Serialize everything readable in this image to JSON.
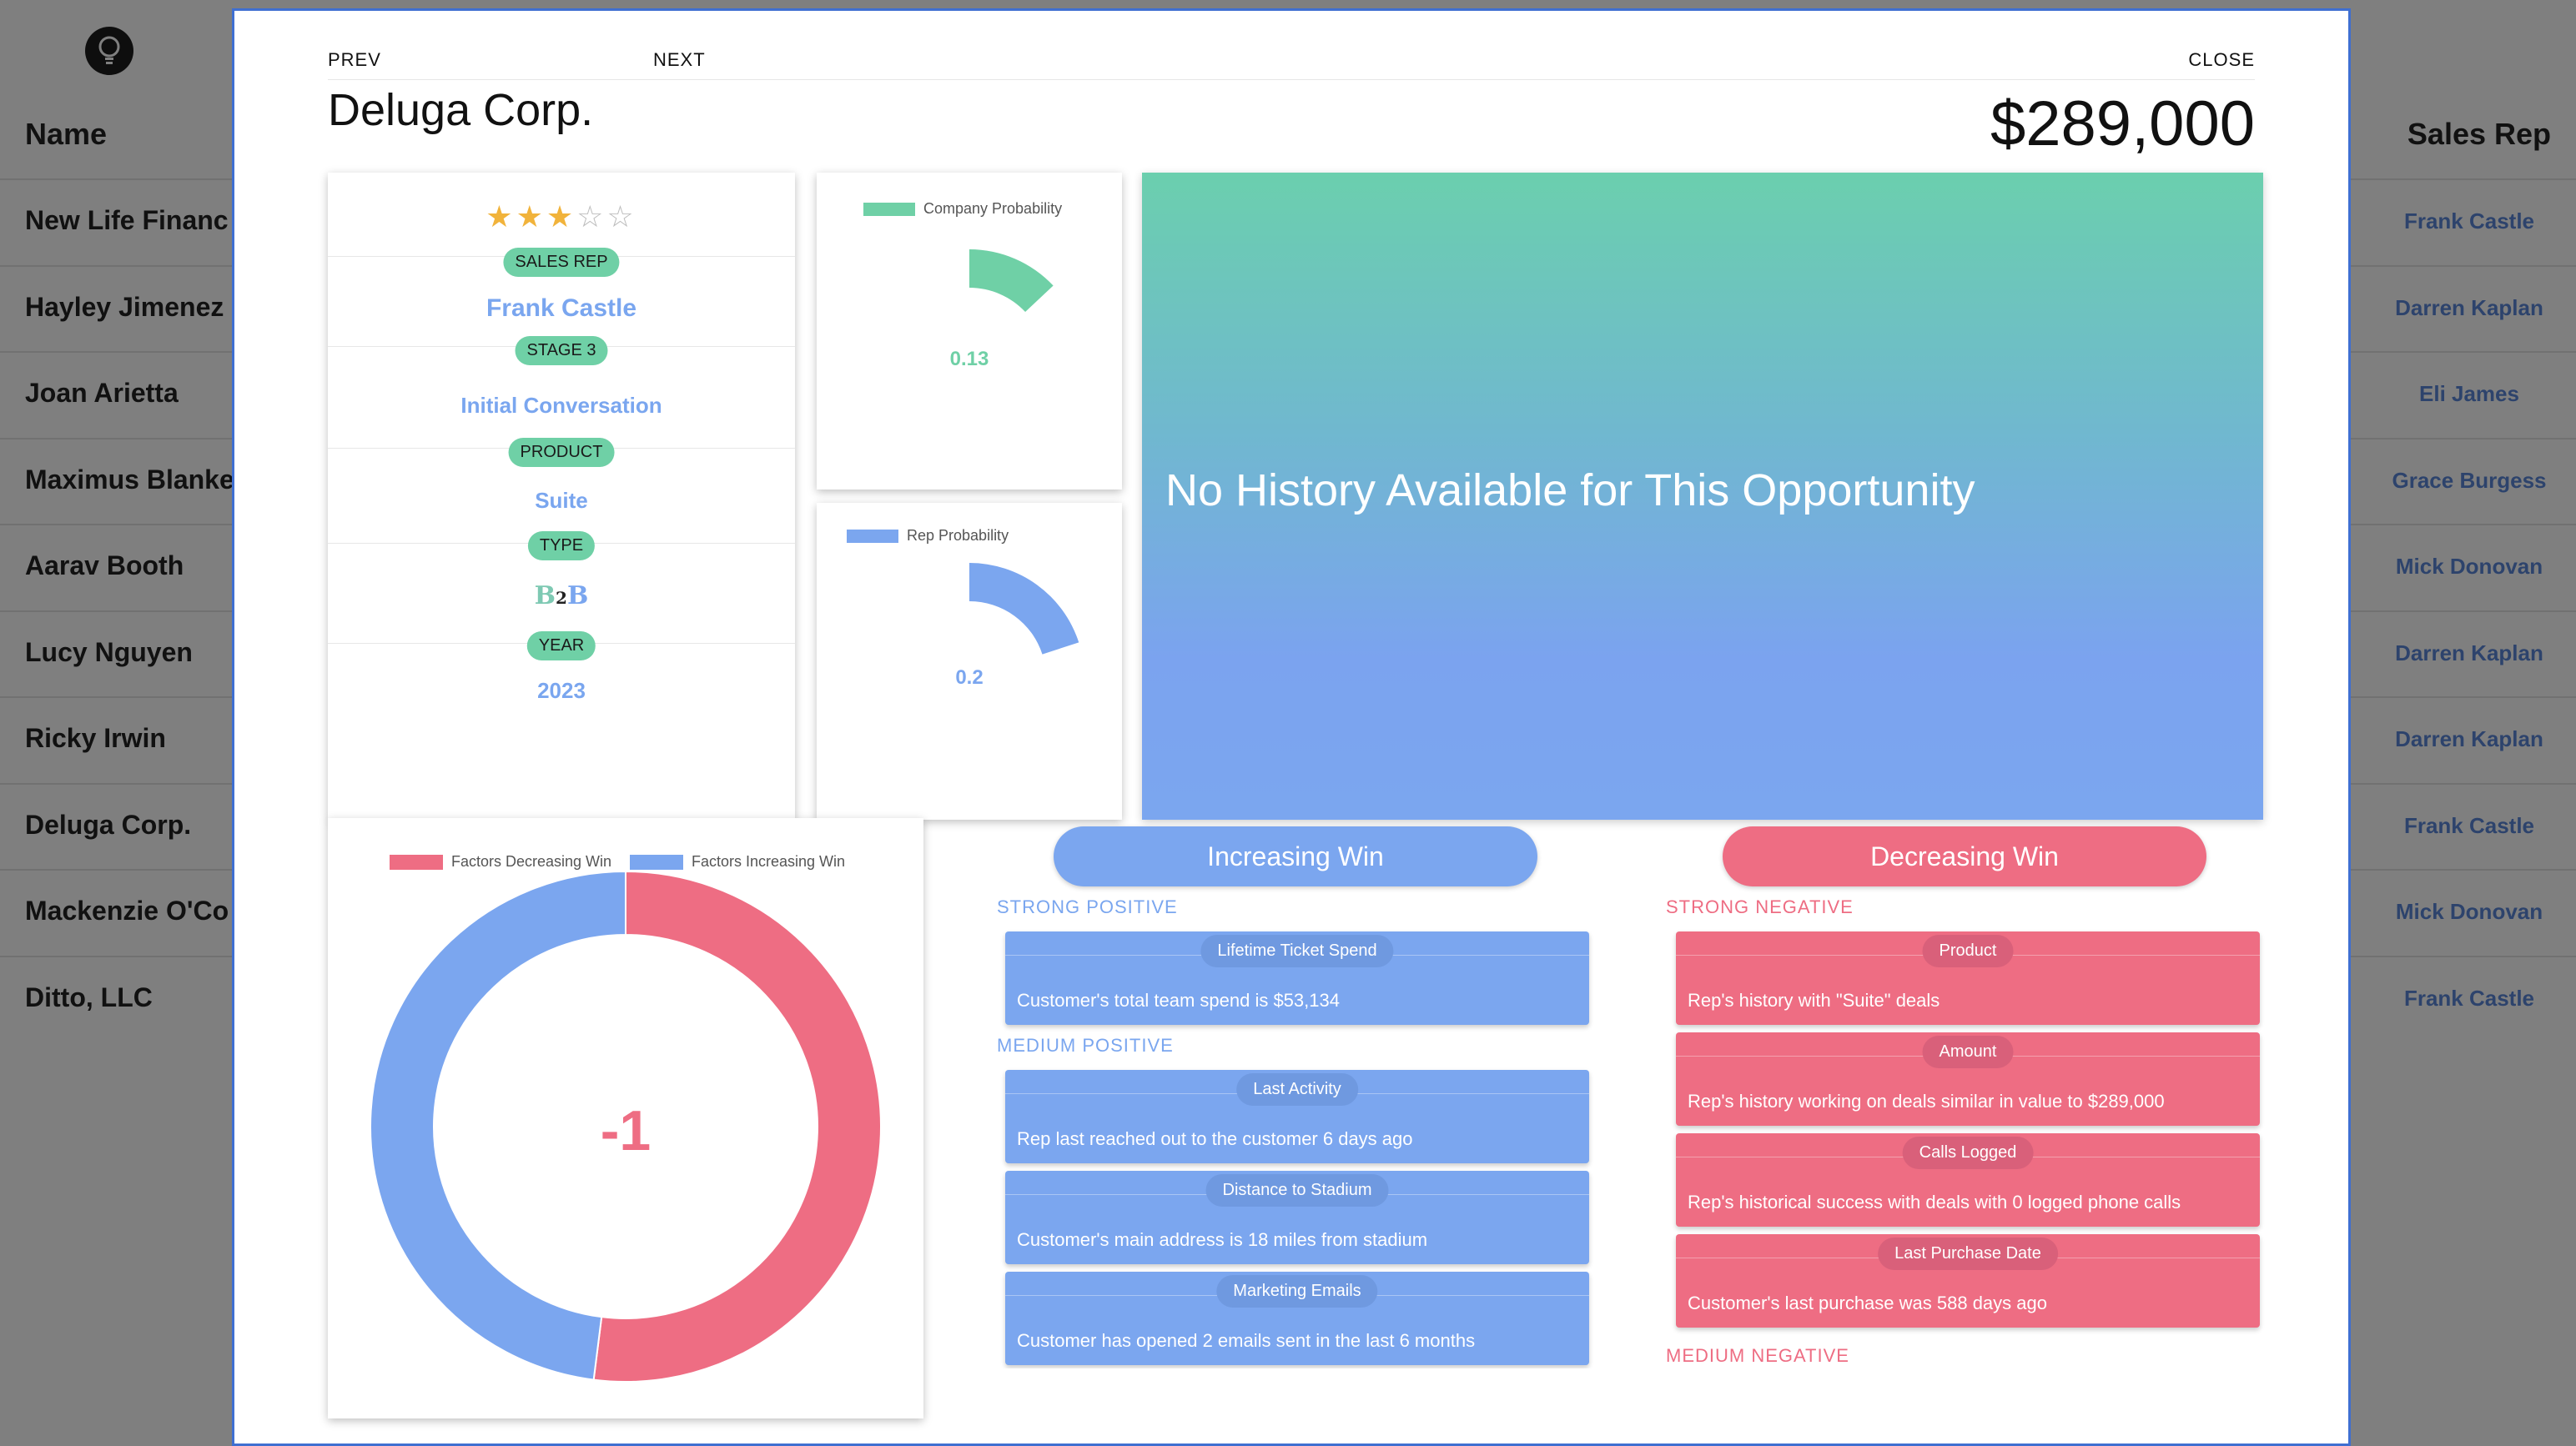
{
  "background": {
    "name_header": "Name",
    "rep_header": "Sales Rep",
    "rows": [
      {
        "name": "New Life Financ",
        "rep": "Frank Castle"
      },
      {
        "name": "Hayley Jimenez",
        "rep": "Darren Kaplan"
      },
      {
        "name": "Joan Arietta",
        "rep": "Eli James"
      },
      {
        "name": "Maximus Blanke",
        "rep": "Grace Burgess"
      },
      {
        "name": "Aarav Booth",
        "rep": "Mick Donovan"
      },
      {
        "name": "Lucy Nguyen",
        "rep": "Darren Kaplan"
      },
      {
        "name": "Ricky Irwin",
        "rep": "Darren Kaplan"
      },
      {
        "name": "Deluga Corp.",
        "rep": "Frank Castle"
      },
      {
        "name": "Mackenzie O'Co",
        "rep": "Mick Donovan"
      },
      {
        "name": "Ditto, LLC",
        "rep": "Frank Castle"
      }
    ]
  },
  "modal": {
    "nav": {
      "prev": "PREV",
      "next": "NEXT",
      "close": "CLOSE"
    },
    "company": "Deluga Corp.",
    "amount": "$289,000",
    "rating": {
      "value": 3,
      "max": 5
    },
    "info": {
      "sales_rep_label": "SALES REP",
      "sales_rep": "Frank Castle",
      "stage_label": "STAGE 3",
      "stage": "Initial Conversation",
      "product_label": "PRODUCT",
      "product": "Suite",
      "type_label": "TYPE",
      "type_logo": {
        "left": "B",
        "mid": "2",
        "right": "B"
      },
      "year_label": "YEAR",
      "year": "2023"
    },
    "gauges": [
      {
        "legend": "Company Probability",
        "value": 0.13,
        "value_text": "0.13",
        "color": "#6fd0a6"
      },
      {
        "legend": "Rep Probability",
        "value": 0.2,
        "value_text": "0.2",
        "color": "#7ba6ef"
      }
    ],
    "history_message": "No History Available for This Opportunity",
    "donut": {
      "legend_decreasing": "Factors Decreasing Win",
      "legend_increasing": "Factors Increasing Win",
      "center_value": "-1",
      "colors": {
        "decreasing": "#ee6d83",
        "increasing": "#7ba6ef"
      }
    },
    "increasing": {
      "button": "Increasing Win",
      "strong_label": "STRONG POSITIVE",
      "strong": [
        {
          "tag": "Lifetime Ticket Spend",
          "desc": "Customer's total team spend is $53,134"
        }
      ],
      "medium_label": "MEDIUM POSITIVE",
      "medium": [
        {
          "tag": "Last Activity",
          "desc": "Rep last reached out to the customer 6 days ago"
        },
        {
          "tag": "Distance to Stadium",
          "desc": "Customer's main address is 18 miles from stadium"
        },
        {
          "tag": "Marketing Emails",
          "desc": "Customer has opened 2 emails sent in the last 6 months"
        }
      ]
    },
    "decreasing": {
      "button": "Decreasing Win",
      "strong_label": "STRONG NEGATIVE",
      "strong": [
        {
          "tag": "Product",
          "desc": "Rep's history with \"Suite\" deals"
        },
        {
          "tag": "Amount",
          "desc": "Rep's history working on deals similar in value to $289,000"
        },
        {
          "tag": "Calls Logged",
          "desc": "Rep's historical success with deals with 0 logged phone calls"
        },
        {
          "tag": "Last Purchase Date",
          "desc": "Customer's last purchase was 588 days ago"
        }
      ],
      "medium_label": "MEDIUM NEGATIVE"
    }
  },
  "chart_data": [
    {
      "type": "gauge",
      "title": "Company Probability",
      "value": 0.13,
      "range": [
        0,
        1
      ]
    },
    {
      "type": "gauge",
      "title": "Rep Probability",
      "value": 0.2,
      "range": [
        0,
        1
      ]
    },
    {
      "type": "pie",
      "series": [
        {
          "name": "Factors Decreasing Win",
          "value": 0.52
        },
        {
          "name": "Factors Increasing Win",
          "value": 0.48
        }
      ],
      "center_label": "-1"
    }
  ]
}
